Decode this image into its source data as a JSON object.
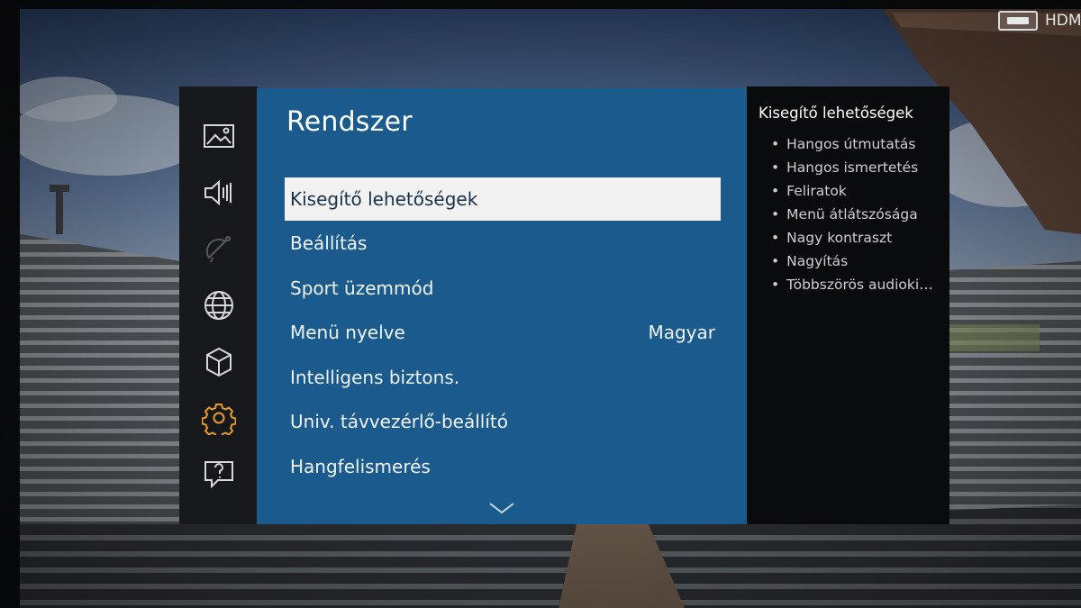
{
  "source": {
    "label": "HDMI",
    "icon": "hdmi-icon"
  },
  "menu_icons": [
    {
      "name": "picture-icon",
      "state": "normal"
    },
    {
      "name": "sound-icon",
      "state": "normal"
    },
    {
      "name": "broadcast-icon",
      "state": "disabled"
    },
    {
      "name": "network-icon",
      "state": "normal"
    },
    {
      "name": "smart-hub-icon",
      "state": "normal"
    },
    {
      "name": "system-gear-icon",
      "state": "active"
    },
    {
      "name": "support-icon",
      "state": "normal"
    }
  ],
  "main": {
    "title": "Rendszer",
    "items": [
      {
        "label": "Kisegítő lehetőségek",
        "value": "",
        "selected": true
      },
      {
        "label": "Beállítás",
        "value": ""
      },
      {
        "label": "Sport üzemmód",
        "value": ""
      },
      {
        "label": "Menü nyelve",
        "value": "Magyar"
      },
      {
        "label": "Intelligens biztons.",
        "value": ""
      },
      {
        "label": "Univ. távvezérlő-beállító",
        "value": ""
      },
      {
        "label": "Hangfelismerés",
        "value": ""
      }
    ]
  },
  "side": {
    "heading": "Kisegítő lehetőségek",
    "items": [
      "Hangos útmutatás",
      "Hangos ismertetés",
      "Feliratok",
      "Menü átlátszósága",
      "Nagy kontraszt",
      "Nagyítás",
      "Többszörös audiokim..."
    ]
  },
  "colors": {
    "main_panel": "#1a5a8c",
    "icon_bar": "#16181b",
    "side_panel": "#0a0b0d",
    "selection": "#f2f2f2",
    "active_icon": "#e89a2a"
  }
}
